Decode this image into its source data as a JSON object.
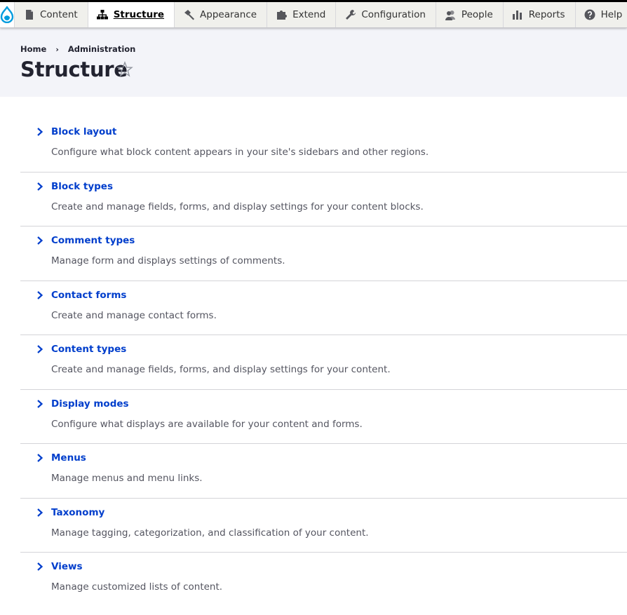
{
  "toolbar": {
    "tabs": [
      {
        "label": "Content",
        "icon": "file-icon"
      },
      {
        "label": "Structure",
        "icon": "sitemap-icon"
      },
      {
        "label": "Appearance",
        "icon": "paintbrush-icon"
      },
      {
        "label": "Extend",
        "icon": "puzzle-icon"
      },
      {
        "label": "Configuration",
        "icon": "wrench-icon"
      },
      {
        "label": "People",
        "icon": "people-icon"
      },
      {
        "label": "Reports",
        "icon": "bar-chart-icon"
      },
      {
        "label": "Help",
        "icon": "help-icon"
      }
    ],
    "active_tab": "Structure",
    "logo_icon": "drupal-drop-icon"
  },
  "breadcrumb": [
    "Home",
    "Administration"
  ],
  "page_title": "Structure",
  "items": [
    {
      "title": "Block layout",
      "description": "Configure what block content appears in your site's sidebars and other regions."
    },
    {
      "title": "Block types",
      "description": "Create and manage fields, forms, and display settings for your content blocks."
    },
    {
      "title": "Comment types",
      "description": "Manage form and displays settings of comments."
    },
    {
      "title": "Contact forms",
      "description": "Create and manage contact forms."
    },
    {
      "title": "Content types",
      "description": "Create and manage fields, forms, and display settings for your content."
    },
    {
      "title": "Display modes",
      "description": "Configure what displays are available for your content and forms."
    },
    {
      "title": "Menus",
      "description": "Manage menus and menu links."
    },
    {
      "title": "Taxonomy",
      "description": "Manage tagging, categorization, and classification of your content."
    },
    {
      "title": "Views",
      "description": "Manage customized lists of content."
    }
  ],
  "colors": {
    "link": "#003ecc",
    "header_bg": "#f3f4f9",
    "text": "#222330",
    "muted_text": "#545560",
    "logo": "#009cde"
  }
}
